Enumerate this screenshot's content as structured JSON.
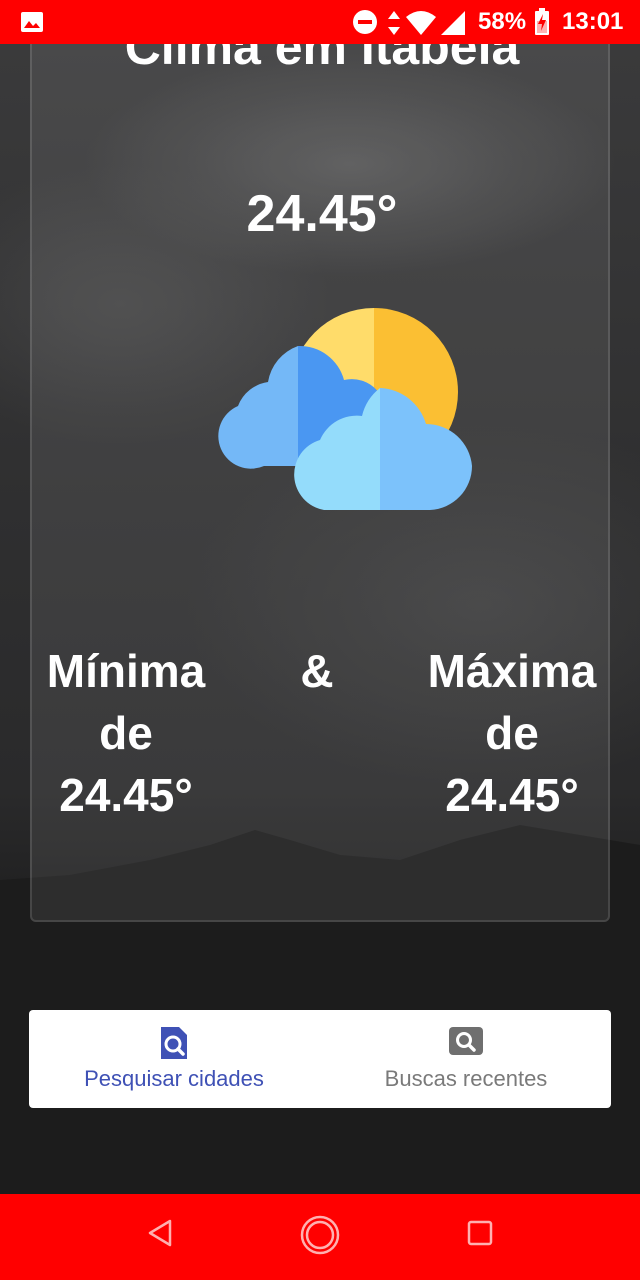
{
  "status_bar": {
    "battery_percent": "58%",
    "time": "13:01",
    "icons": [
      "gallery-icon",
      "do-not-disturb-icon",
      "data-arrows-icon",
      "wifi-icon",
      "signal-icon",
      "battery-charging-icon"
    ]
  },
  "weather": {
    "title": "Clima em Itabela",
    "current_temp": "24.45°",
    "condition_icon": "partly-cloudy-icon",
    "min": {
      "label": "Mínima",
      "connector": "de",
      "value": "24.45°"
    },
    "separator": "&",
    "max": {
      "label": "Máxima",
      "connector": "de",
      "value": "24.45°"
    }
  },
  "bottom_nav": {
    "items": [
      {
        "label": "Pesquisar cidades",
        "icon": "document-search-icon",
        "active": true
      },
      {
        "label": "Buscas recentes",
        "icon": "image-search-icon",
        "active": false
      }
    ]
  },
  "android_nav": {
    "icons": [
      "back-icon",
      "home-icon",
      "recents-icon"
    ]
  },
  "colors": {
    "system_bars": "#ff0000",
    "active_nav": "#3f51b5",
    "inactive_nav": "#7a7a7a",
    "sun_light": "#ffdc6a",
    "sun_dark": "#fbbf33",
    "cloud_back_light": "#74b8f7",
    "cloud_back_dark": "#4a97f2",
    "cloud_front_light": "#94dcfb",
    "cloud_front_dark": "#7cc2fb"
  }
}
